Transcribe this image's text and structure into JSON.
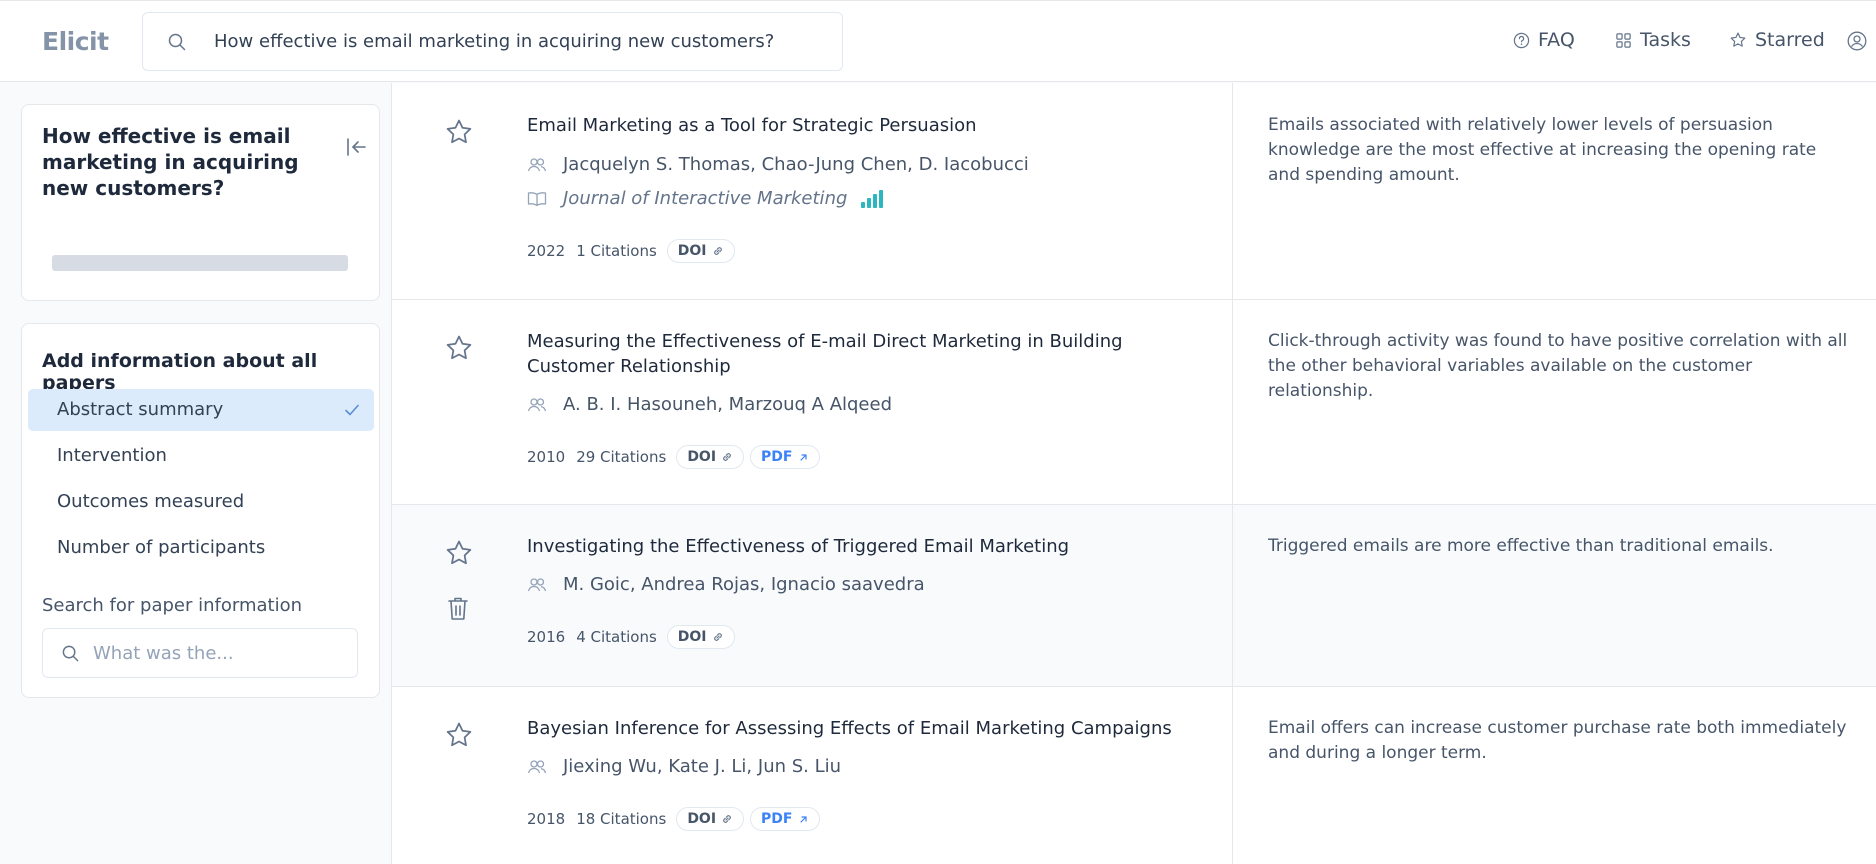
{
  "app": {
    "name": "Elicit"
  },
  "search": {
    "query": "How effective is email marketing in acquiring new customers?"
  },
  "nav": {
    "faq": "FAQ",
    "tasks": "Tasks",
    "starred": "Starred"
  },
  "sidebar": {
    "question": "How effective is email marketing in acquiring new customers?",
    "add_info_title": "Add information about all papers",
    "options": [
      {
        "label": "Abstract summary",
        "selected": true
      },
      {
        "label": "Intervention",
        "selected": false
      },
      {
        "label": "Outcomes measured",
        "selected": false
      },
      {
        "label": "Number of participants",
        "selected": false
      }
    ],
    "search_label": "Search for paper information",
    "search_placeholder": "What was the..."
  },
  "papers": [
    {
      "title": "Email Marketing as a Tool for Strategic Persuasion",
      "authors": "Jacquelyn S. Thomas, Chao-Jung Chen, D. Iacobucci",
      "journal": "Journal of Interactive Marketing",
      "year": "2022",
      "citations": "1 Citations",
      "doi": "DOI",
      "summary": "Emails associated with relatively lower levels of persuasion knowledge are the most effective at increasing the opening rate and spending amount."
    },
    {
      "title": "Measuring the Effectiveness of E-mail Direct Marketing in Building Customer Relationship",
      "authors": "A. B. I. Hasouneh, Marzouq A Alqeed",
      "year": "2010",
      "citations": "29 Citations",
      "doi": "DOI",
      "pdf": "PDF",
      "summary": "Click-through activity was found to have positive correlation with all the other behavioral variables available on the customer relationship."
    },
    {
      "title": "Investigating the Effectiveness of Triggered Email Marketing",
      "authors": "M. Goic, Andrea Rojas, Ignacio saavedra",
      "year": "2016",
      "citations": "4 Citations",
      "doi": "DOI",
      "summary": "Triggered emails are more effective than traditional emails."
    },
    {
      "title": "Bayesian Inference for Assessing Effects of Email Marketing Campaigns",
      "authors": "Jiexing Wu, Kate J. Li, Jun S. Liu",
      "year": "2018",
      "citations": "18 Citations",
      "doi": "DOI",
      "pdf": "PDF",
      "summary": "Email offers can increase customer purchase rate both immediately and during a longer term."
    }
  ],
  "colors": {
    "accent": "#3b82f6",
    "selected_bg": "#dcebfb",
    "quality_bars": "#2ab7c0"
  }
}
